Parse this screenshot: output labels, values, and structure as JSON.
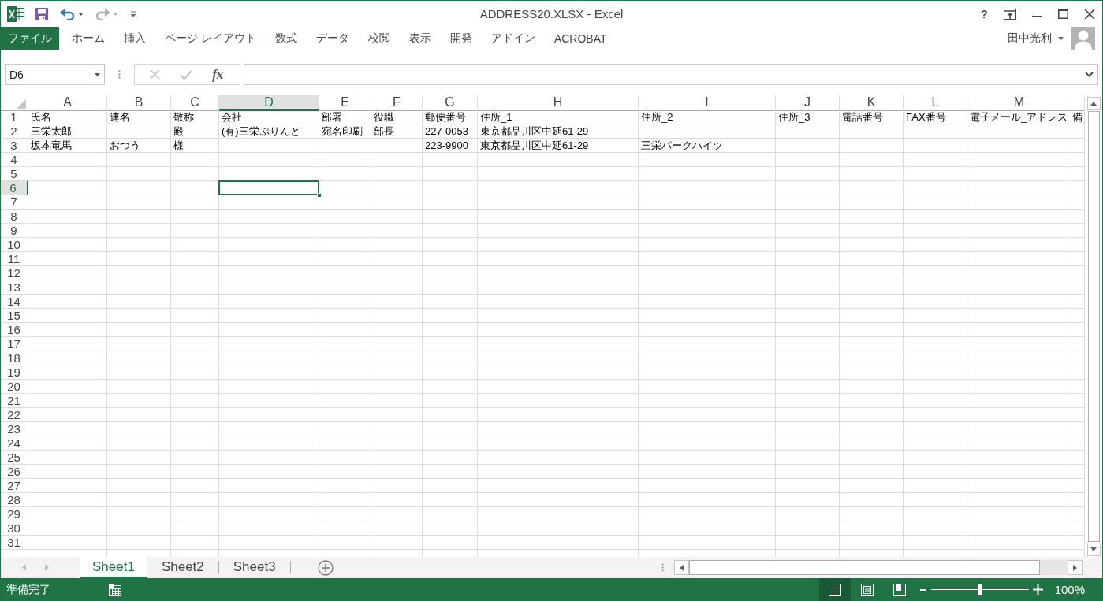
{
  "window": {
    "title": "ADDRESS20.XLSX - Excel",
    "help_label": "?"
  },
  "quick_access": [
    {
      "kind": "save",
      "disabled": false
    },
    {
      "kind": "undo",
      "disabled": false
    },
    {
      "kind": "redo",
      "disabled": true
    },
    {
      "kind": "customize",
      "disabled": false
    }
  ],
  "ribbon_tabs": [
    {
      "label": "ファイル",
      "kind": "file",
      "selected": false
    },
    {
      "label": "ホーム",
      "kind": "tab",
      "selected": false
    },
    {
      "label": "挿入",
      "kind": "tab",
      "selected": false
    },
    {
      "label": "ページ レイアウト",
      "kind": "tab",
      "selected": false
    },
    {
      "label": "数式",
      "kind": "tab",
      "selected": false
    },
    {
      "label": "データ",
      "kind": "tab",
      "selected": false
    },
    {
      "label": "校閲",
      "kind": "tab",
      "selected": false
    },
    {
      "label": "表示",
      "kind": "tab",
      "selected": false
    },
    {
      "label": "開発",
      "kind": "tab",
      "selected": false
    },
    {
      "label": "アドイン",
      "kind": "tab",
      "selected": false
    },
    {
      "label": "ACROBAT",
      "kind": "tab",
      "selected": false
    }
  ],
  "account": {
    "user": "田中光利"
  },
  "formula_bar": {
    "name_box": "D6",
    "cancel_disabled": true,
    "enter_disabled": true,
    "function_button": "fx"
  },
  "sheet": {
    "columns": [
      {
        "label": "A",
        "selected": false
      },
      {
        "label": "B",
        "selected": false
      },
      {
        "label": "C",
        "selected": false
      },
      {
        "label": "D",
        "selected": true
      },
      {
        "label": "E",
        "selected": false
      },
      {
        "label": "F",
        "selected": false
      },
      {
        "label": "G",
        "selected": false
      },
      {
        "label": "H",
        "selected": false
      },
      {
        "label": "I",
        "selected": false
      },
      {
        "label": "J",
        "selected": false
      },
      {
        "label": "K",
        "selected": false
      },
      {
        "label": "L",
        "selected": false
      },
      {
        "label": "M",
        "selected": false
      }
    ],
    "rows": [
      {
        "number": "1",
        "selected": false,
        "cells": [
          "氏名",
          "連名",
          "敬称",
          "会社",
          "部署",
          "役職",
          "郵便番号",
          "住所_1",
          "住所_2",
          "住所_3",
          "電話番号",
          "FAX番号",
          "電子メール_アドレス",
          "備"
        ]
      },
      {
        "number": "2",
        "selected": false,
        "cells": [
          "三栄太郎",
          null,
          "殿",
          "(有)三栄ぷりんと",
          "宛名印刷",
          "部長",
          "227-0053",
          "東京都品川区中延61-29"
        ]
      },
      {
        "number": "3",
        "selected": false,
        "cells": [
          "坂本竜馬",
          "おつう",
          "様",
          null,
          null,
          null,
          "223-9900",
          "東京都品川区中延61-29",
          "三栄パークハイツ"
        ]
      },
      {
        "number": "4",
        "selected": false
      },
      {
        "number": "5",
        "selected": false
      },
      {
        "number": "6",
        "selected": true
      },
      {
        "number": "7",
        "selected": false
      },
      {
        "number": "8",
        "selected": false
      },
      {
        "number": "9",
        "selected": false
      },
      {
        "number": "10",
        "selected": false
      },
      {
        "number": "11",
        "selected": false
      },
      {
        "number": "12",
        "selected": false
      },
      {
        "number": "13",
        "selected": false
      },
      {
        "number": "14",
        "selected": false
      },
      {
        "number": "15",
        "selected": false
      },
      {
        "number": "16",
        "selected": false
      },
      {
        "number": "17",
        "selected": false
      },
      {
        "number": "18",
        "selected": false
      },
      {
        "number": "19",
        "selected": false
      },
      {
        "number": "20",
        "selected": false
      },
      {
        "number": "21",
        "selected": false
      },
      {
        "number": "22",
        "selected": false
      },
      {
        "number": "23",
        "selected": false
      },
      {
        "number": "24",
        "selected": false
      },
      {
        "number": "25",
        "selected": false
      },
      {
        "number": "26",
        "selected": false
      },
      {
        "number": "27",
        "selected": false
      },
      {
        "number": "28",
        "selected": false
      },
      {
        "number": "29",
        "selected": false
      },
      {
        "number": "30",
        "selected": false
      },
      {
        "number": "31",
        "selected": false
      }
    ]
  },
  "sheet_nav": [
    {
      "kind": "previous",
      "disabled": true
    },
    {
      "kind": "next",
      "disabled": true
    }
  ],
  "sheet_tabs": [
    {
      "label": "Sheet1",
      "selected": true
    },
    {
      "label": "Sheet2",
      "selected": false
    },
    {
      "label": "Sheet3",
      "selected": false
    }
  ],
  "status_bar": {
    "status": "準備完了",
    "views": [
      {
        "kind": "normal",
        "selected": true
      },
      {
        "kind": "page_layout",
        "selected": false
      },
      {
        "kind": "page_break",
        "selected": false
      }
    ],
    "zoom": {
      "level": 0.5,
      "reading": "100%"
    }
  }
}
